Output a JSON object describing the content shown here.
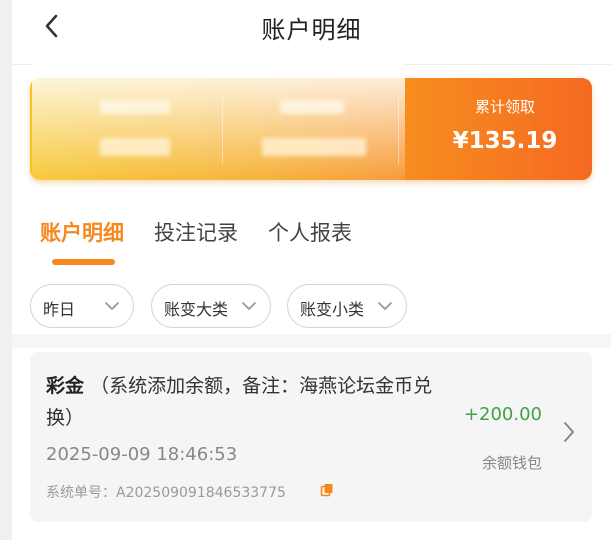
{
  "header": {
    "title": "账户明细",
    "back_icon": "chevron-left-icon"
  },
  "summary": {
    "cumulative_label": "累计领取",
    "cumulative_value": "¥135.19",
    "colors": {
      "start": "#f6c21f",
      "end": "#f56a22"
    }
  },
  "tabs": [
    {
      "label": "账户明细",
      "active": true
    },
    {
      "label": "投注记录",
      "active": false
    },
    {
      "label": "个人报表",
      "active": false
    }
  ],
  "filters": [
    {
      "label": "昨日"
    },
    {
      "label": "账变大类"
    },
    {
      "label": "账变小类"
    }
  ],
  "record": {
    "category": "彩金",
    "description": "（系统添加余额，备注：海燕论坛金币兑换）",
    "amount": "+200.00",
    "wallet": "余额钱包",
    "time": "2025-09-09 18:46:53",
    "order_label": "系统单号：",
    "order_no": "A202509091846533775"
  },
  "accent_color": "#f5891f",
  "positive_color": "#43a047"
}
